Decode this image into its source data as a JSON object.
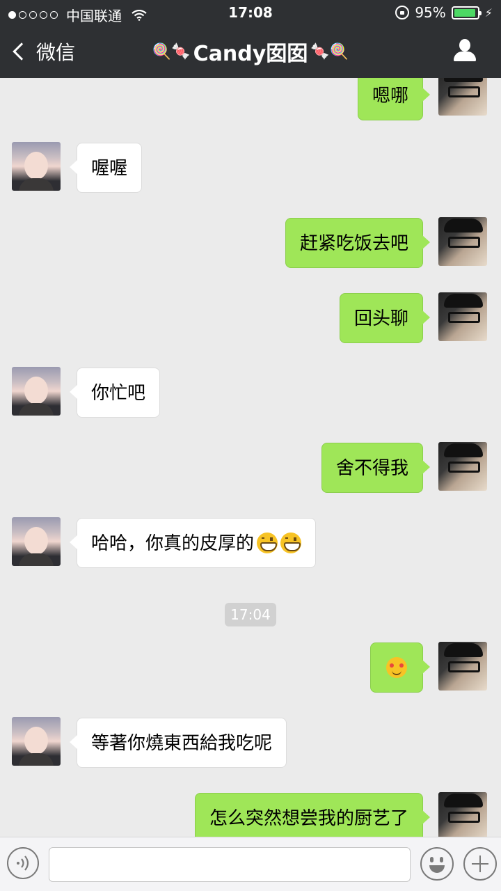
{
  "status_bar": {
    "carrier": "中国联通",
    "time": "17:08",
    "battery": "95%",
    "battery_level": 0.95,
    "signal_bars": 1,
    "signal_total": 5
  },
  "nav": {
    "back_label": "微信",
    "contact_name": "Candy囡囡",
    "title_deco_left": "🍭🍬",
    "title_deco_right": "🍬🍭",
    "icons": {
      "back": "chevron-left-icon",
      "profile": "person-icon"
    }
  },
  "messages": [
    {
      "from": "me",
      "text": "嗯哪",
      "emoji": []
    },
    {
      "from": "her",
      "text": "喔喔",
      "emoji": []
    },
    {
      "from": "me",
      "text": "赶紧吃饭去吧",
      "emoji": []
    },
    {
      "from": "me",
      "text": "回头聊",
      "emoji": []
    },
    {
      "from": "her",
      "text": "你忙吧",
      "emoji": []
    },
    {
      "from": "me",
      "text": "舍不得我",
      "emoji": []
    },
    {
      "from": "her",
      "text": "哈哈，你真的皮厚的",
      "emoji": [
        "grinning-face",
        "grinning-face"
      ]
    },
    {
      "from": "me",
      "text": "",
      "emoji": [
        "blushing-face"
      ]
    },
    {
      "from": "her",
      "text": "等著你燒東西給我吃呢",
      "emoji": []
    },
    {
      "from": "me",
      "text": "怎么突然想尝我的厨艺了",
      "emoji": []
    }
  ],
  "timestamp": "17:04",
  "input_bar": {
    "text_value": "",
    "icons": {
      "voice": "voice-icon",
      "emoji": "emoji-face-icon",
      "more": "plus-icon"
    }
  },
  "colors": {
    "nav_bg": "#2e3033",
    "chat_bg": "#ebebeb",
    "my_bubble": "#9fe658",
    "her_bubble": "#ffffff",
    "battery_fill": "#4cd964"
  }
}
